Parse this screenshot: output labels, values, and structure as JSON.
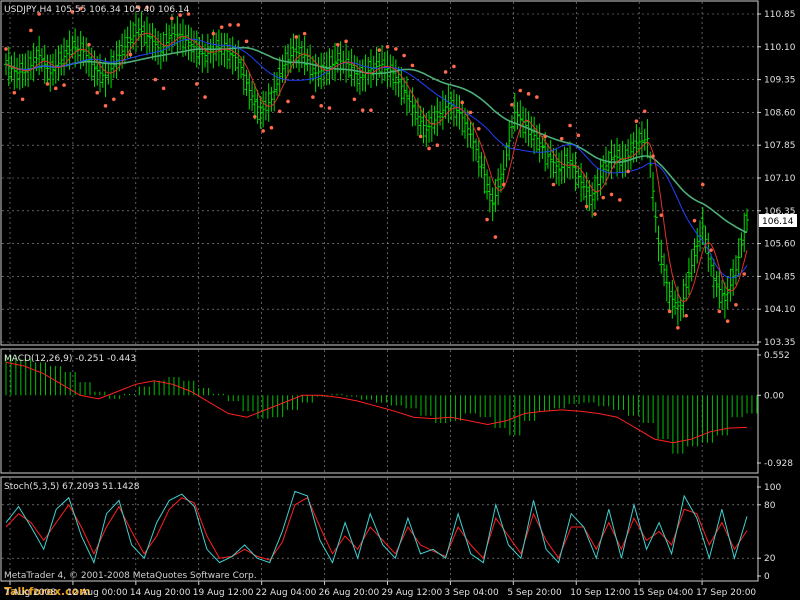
{
  "chart_data": [
    {
      "type": "candlestick",
      "title": "USDJPY,H4  105.55 106.34 105.40 106.14",
      "symbol": "USDJPY,H4",
      "ohlc_header": {
        "open": 105.55,
        "high": 106.34,
        "low": 105.4,
        "close": 106.14
      },
      "current_price_label": "106.14",
      "y_ticks": [
        "110.85",
        "110.10",
        "109.35",
        "108.60",
        "107.85",
        "107.10",
        "106.35",
        "105.60",
        "104.85",
        "104.10",
        "103.35"
      ],
      "ylim": [
        103.35,
        110.85
      ],
      "close_series": [
        109.7,
        109.5,
        109.6,
        109.9,
        109.5,
        109.8,
        110.1,
        110.0,
        109.6,
        109.4,
        109.8,
        110.2,
        110.5,
        110.3,
        110.0,
        110.4,
        110.3,
        110.1,
        109.9,
        110.1,
        110.0,
        109.8,
        109.1,
        108.6,
        108.9,
        109.6,
        110.0,
        109.9,
        109.5,
        109.6,
        109.8,
        109.7,
        109.4,
        109.6,
        109.7,
        109.5,
        109.1,
        108.6,
        108.2,
        108.5,
        108.8,
        108.6,
        108.1,
        107.4,
        106.5,
        107.3,
        108.6,
        108.3,
        108.0,
        107.6,
        107.3,
        107.5,
        107.0,
        106.6,
        107.3,
        107.6,
        107.5,
        107.9,
        108.0,
        105.6,
        104.4,
        104.1,
        105.1,
        106.0,
        104.8,
        104.3,
        105.0,
        106.14
      ],
      "color": "#00e000"
    },
    {
      "type": "macd",
      "title": "MACD(12,26,9) -0.251 -0.443",
      "y_ticks": [
        "0.552",
        "0.00",
        "-0.928"
      ],
      "ylim": [
        -0.928,
        0.552
      ],
      "histogram": [
        0.55,
        0.5,
        0.45,
        0.4,
        0.32,
        0.18,
        0.05,
        -0.05,
        0.02,
        0.12,
        0.2,
        0.25,
        0.2,
        0.1,
        0.02,
        -0.08,
        -0.22,
        -0.32,
        -0.3,
        -0.2,
        -0.1,
        -0.02,
        0.02,
        -0.02,
        -0.06,
        -0.1,
        -0.14,
        -0.18,
        -0.28,
        -0.38,
        -0.35,
        -0.25,
        -0.3,
        -0.45,
        -0.55,
        -0.35,
        -0.22,
        -0.18,
        -0.12,
        -0.1,
        -0.15,
        -0.2,
        -0.28,
        -0.38,
        -0.6,
        -0.8,
        -0.7,
        -0.65,
        -0.55,
        -0.3,
        -0.25
      ],
      "signal": [
        0.45,
        0.4,
        0.3,
        0.15,
        0.0,
        -0.05,
        0.05,
        0.15,
        0.2,
        0.15,
        0.05,
        -0.1,
        -0.25,
        -0.3,
        -0.2,
        -0.1,
        0.0,
        0.0,
        -0.03,
        -0.08,
        -0.15,
        -0.22,
        -0.3,
        -0.32,
        -0.3,
        -0.35,
        -0.4,
        -0.35,
        -0.25,
        -0.22,
        -0.2,
        -0.22,
        -0.25,
        -0.3,
        -0.45,
        -0.6,
        -0.65,
        -0.6,
        -0.5,
        -0.45,
        -0.44
      ],
      "colors": {
        "histogram": "#00c000",
        "signal": "#ff2020"
      }
    },
    {
      "type": "stochastic",
      "title": "Stoch(5,3,5) 67.2093 51.1428",
      "y_ticks": [
        "100",
        "80",
        "20",
        "0"
      ],
      "ylim": [
        0,
        100
      ],
      "main": [
        60,
        78,
        55,
        30,
        75,
        88,
        45,
        15,
        70,
        85,
        35,
        20,
        60,
        85,
        92,
        78,
        30,
        15,
        22,
        35,
        20,
        15,
        50,
        95,
        90,
        40,
        15,
        60,
        20,
        70,
        35,
        20,
        65,
        25,
        30,
        20,
        70,
        25,
        15,
        80,
        35,
        20,
        85,
        30,
        15,
        70,
        55,
        20,
        75,
        20,
        80,
        30,
        60,
        25,
        90,
        65,
        20,
        75,
        20,
        67
      ],
      "signal": [
        55,
        70,
        60,
        40,
        60,
        80,
        55,
        25,
        55,
        78,
        50,
        25,
        45,
        75,
        88,
        82,
        45,
        20,
        22,
        30,
        22,
        18,
        38,
        80,
        88,
        55,
        25,
        45,
        30,
        55,
        40,
        25,
        55,
        35,
        28,
        22,
        55,
        35,
        20,
        65,
        45,
        25,
        70,
        40,
        20,
        55,
        55,
        30,
        60,
        30,
        65,
        40,
        50,
        35,
        75,
        70,
        35,
        60,
        30,
        51
      ],
      "colors": {
        "main": "#40d0d0",
        "signal": "#ff2020"
      }
    }
  ],
  "x_ticks": [
    "7 Aug 2008",
    "12 Aug 00:00",
    "14 Aug 20:00",
    "19 Aug 12:00",
    "22 Aug 04:00",
    "26 Aug 20:00",
    "29 Aug 12:00",
    "3 Sep 04:00",
    "5 Sep 20:00",
    "10 Sep 12:00",
    "15 Sep 04:00",
    "17 Sep 20:00"
  ],
  "watermark": {
    "line1": "MetaTrader 4, © 2001-2008 MetaQuotes Software Corp.",
    "line2": "Talkforex.com"
  }
}
